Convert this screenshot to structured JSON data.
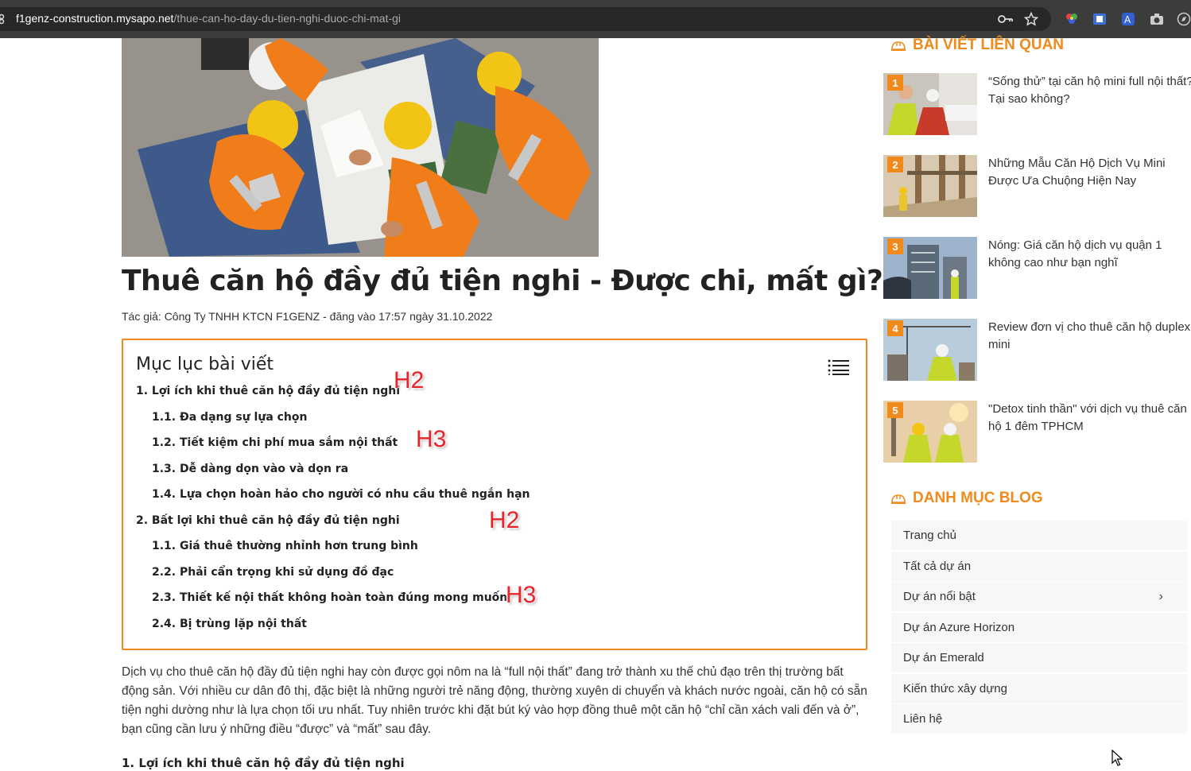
{
  "browser": {
    "url_host": "f1genz-construction.mysapo.net",
    "url_path": "/thue-can-ho-day-du-tien-nghi-duoc-chi-mat-gi"
  },
  "article": {
    "title": "Thuê căn hộ đầy đủ tiện nghi - Được chi, mất gì?",
    "meta": "Tác giả: Công Ty TNHH KTCN F1GENZ - đăng vào 17:57 ngày 31.10.2022",
    "intro": "Dịch vụ cho thuê căn hộ đầy đủ tiện nghi hay còn được gọi nôm na là “full nội thất” đang trở thành xu thế chủ đạo trên thị trường bất động sản. Với nhiều cư dân đô thị, đặc biệt là những người trẻ năng động, thường xuyên di chuyển và khách nước ngoài, căn hộ có sẵn tiện nghi dường như là lựa chọn tối ưu nhất. Tuy nhiên trước khi đặt bút ký vào hợp đồng thuê một căn hộ “chỉ cần xách vali đến và ở”, bạn cũng cần lưu ý những điều “được” và “mất” sau đây.",
    "section1": "1. Lợi ích khi thuê căn hộ đầy đủ tiện nghi"
  },
  "toc": {
    "title": "Mục lục bài viết",
    "items": [
      "1. Lợi ích khi thuê căn hộ đầy đủ tiện nghi",
      "1.1. Đa dạng sự lựa chọn",
      "1.2. Tiết kiệm chi phí mua sắm nội thất",
      "1.3. Dễ dàng dọn vào và dọn ra",
      "1.4. Lựa chọn hoàn hảo cho người có nhu cầu thuê ngắn hạn",
      "2. Bất lợi khi thuê căn hộ đầy đủ tiện nghi",
      "1.1. Giá thuê thường nhỉnh hơn trung bình",
      "2.2. Phải cẩn trọng khi sử dụng đồ đạc",
      "2.3. Thiết kế nội thất không hoàn toàn đúng mong muốn",
      "2.4. Bị trùng lặp nội thất"
    ],
    "annotations": [
      "H2",
      "H3",
      "H2",
      "H3"
    ]
  },
  "sidebar": {
    "related_heading": "BÀI VIẾT LIÊN QUAN",
    "related": [
      {
        "num": "1",
        "title": "“Sống thử” tại căn hộ mini full nội thất? Tại sao không?"
      },
      {
        "num": "2",
        "title": "Những Mẫu Căn Hộ Dịch Vụ Mini Được Ưa Chuộng Hiện Nay"
      },
      {
        "num": "3",
        "title": "Nóng: Giá căn hộ dịch vụ quận 1 không cao như bạn nghĩ"
      },
      {
        "num": "4",
        "title": "Review đơn vị cho thuê căn hộ duplex mini"
      },
      {
        "num": "5",
        "title": "\"Detox tinh thần\" với dịch vụ thuê căn hộ 1 đêm TPHCM"
      }
    ],
    "categories_heading": "DANH MỤC BLOG",
    "categories": [
      "Trang chủ",
      "Tất cả dự án",
      "Dự án nổi bật",
      "Dự án Azure Horizon",
      "Dự án Emerald",
      "Kiến thức xây dựng",
      "Liên hệ"
    ],
    "categories_submenu_arrow": "›"
  },
  "colors": {
    "accent": "#f08a1c",
    "annotation": "#e8232a",
    "browser_bar": "#3c3c3c"
  }
}
